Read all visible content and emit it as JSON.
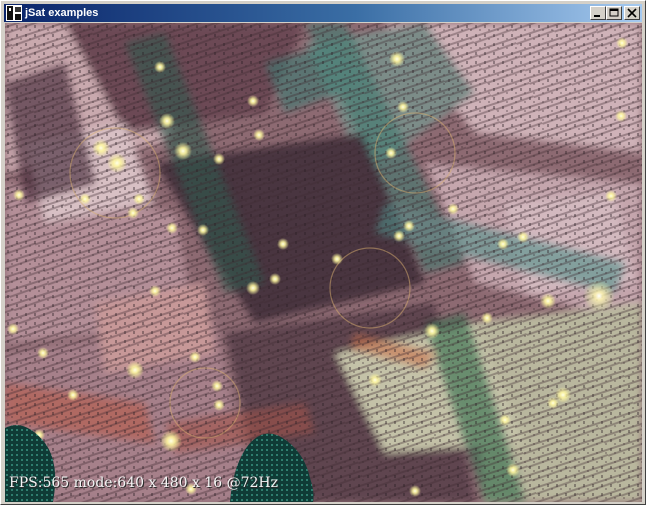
{
  "window": {
    "title": "jSat examples"
  },
  "titlebar_buttons": [
    {
      "name": "minimize-button",
      "icon": "minimize-icon"
    },
    {
      "name": "maximize-button",
      "icon": "maximize-icon"
    },
    {
      "name": "close-button",
      "icon": "close-icon"
    }
  ],
  "overlay": {
    "fps_text": "FPS:565 mode:640 x 480 x 16 @72Hz"
  },
  "colors": {
    "title_start": "#0a246a",
    "title_end": "#a6caf0",
    "glow": "#fffcb0"
  }
}
